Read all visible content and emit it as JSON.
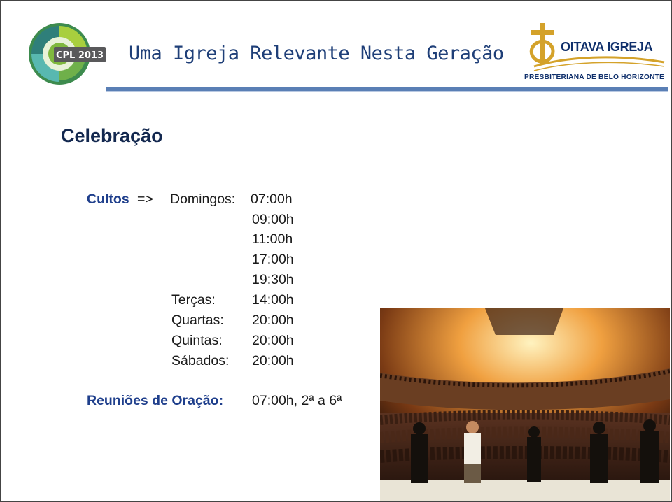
{
  "header": {
    "event_logo_text": "CPL 2013",
    "tagline": "Uma Igreja Relevante Nesta Geração",
    "church_name": "OITAVA IGREJA",
    "church_subtitle": "PRESBITERIANA DE BELO HORIZONTE"
  },
  "slide": {
    "title": "Celebração",
    "cultos_label": "Cultos",
    "arrow": "=>",
    "schedule": [
      {
        "day": "Domingos:",
        "time": "07:00h"
      },
      {
        "day": "",
        "time": "09:00h"
      },
      {
        "day": "",
        "time": "11:00h"
      },
      {
        "day": "",
        "time": "17:00h"
      },
      {
        "day": "",
        "time": "19:30h"
      },
      {
        "day": "Terças:",
        "time": "14:00h"
      },
      {
        "day": "Quartas:",
        "time": "20:00h"
      },
      {
        "day": "Quintas:",
        "time": "20:00h"
      },
      {
        "day": "Sábados:",
        "time": "20:00h"
      }
    ],
    "prayer_label": "Reuniões de Oração:",
    "prayer_value": "07:00h,  2ª a 6ª"
  },
  "colors": {
    "accent_blue": "#1f3f8c",
    "header_rule": "#5a7fb5"
  }
}
